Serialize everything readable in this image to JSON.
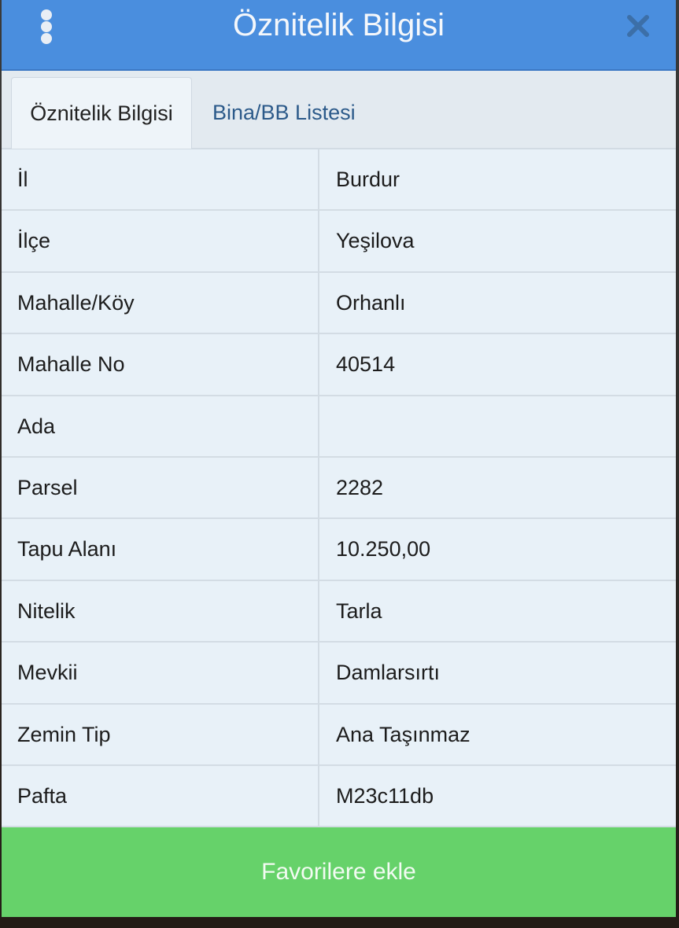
{
  "header": {
    "title": "Öznitelik Bilgisi",
    "menu_icon": "vertical-dots-icon",
    "close_icon": "close-icon"
  },
  "tabs": [
    {
      "label": "Öznitelik Bilgisi",
      "active": true
    },
    {
      "label": "Bina/BB Listesi",
      "active": false
    }
  ],
  "rows": [
    {
      "key": "İl",
      "value": "Burdur"
    },
    {
      "key": "İlçe",
      "value": "Yeşilova"
    },
    {
      "key": "Mahalle/Köy",
      "value": "Orhanlı"
    },
    {
      "key": "Mahalle No",
      "value": "40514"
    },
    {
      "key": "Ada",
      "value": ""
    },
    {
      "key": "Parsel",
      "value": "2282"
    },
    {
      "key": "Tapu Alanı",
      "value": "10.250,00"
    },
    {
      "key": "Nitelik",
      "value": "Tarla"
    },
    {
      "key": "Mevkii",
      "value": "Damlarsırtı"
    },
    {
      "key": "Zemin Tip",
      "value": "Ana Taşınmaz"
    },
    {
      "key": "Pafta",
      "value": "M23c11db"
    }
  ],
  "footer": {
    "favorite_label": "Favorilere ekle"
  },
  "colors": {
    "header": "#4a8ede",
    "favorite_button": "#66d26a",
    "table_background": "#e8f1f8"
  }
}
